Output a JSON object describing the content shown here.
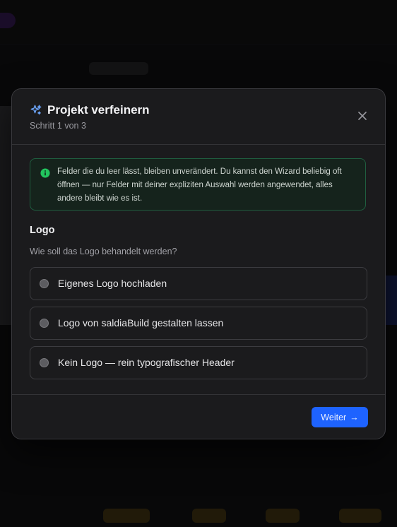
{
  "dialog": {
    "title": "Projekt verfeinern",
    "step": "Schritt 1 von 3",
    "icons": {
      "title_icon": "sparkle-icon",
      "close_icon": "close-icon",
      "info_icon": "info-icon",
      "next_icon": "arrow-right-icon"
    }
  },
  "info": {
    "text": "Felder die du leer lässt, bleiben unverändert. Du kannst den Wizard beliebig oft öffnen — nur Felder mit deiner expliziten Auswahl werden angewendet, alles andere bleibt wie es ist."
  },
  "section": {
    "title": "Logo",
    "question": "Wie soll das Logo behandelt werden?",
    "options": [
      {
        "label": "Eigenes Logo hochladen",
        "selected": false
      },
      {
        "label": "Logo von saldiaBuild gestalten lassen",
        "selected": false
      },
      {
        "label": "Kein Logo — rein typografischer Header",
        "selected": false
      }
    ]
  },
  "footer": {
    "next_label": "Weiter",
    "next_arrow": "→"
  },
  "colors": {
    "accent": "#1e63ff",
    "info_border": "#1f5e3f",
    "info_icon": "#22c55e",
    "title_icon": "#6ea8ff"
  }
}
